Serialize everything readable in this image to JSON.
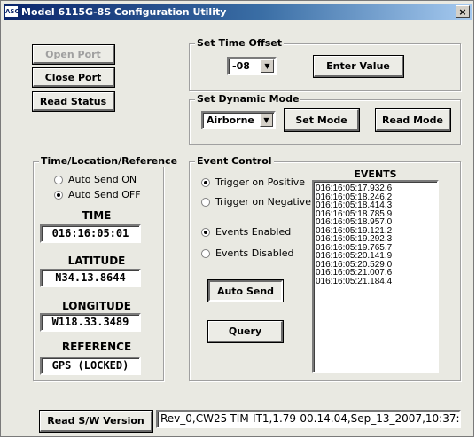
{
  "window": {
    "title": "Model 6115G-8S Configuration Utility",
    "logo_text": "ASC",
    "close_symbol": "×"
  },
  "port_buttons": {
    "open": "Open Port",
    "close": "Close Port",
    "read_status": "Read Status"
  },
  "time_offset": {
    "legend": "Set Time Offset",
    "value": "-08",
    "enter_label": "Enter Value"
  },
  "dynamic_mode": {
    "legend": "Set Dynamic Mode",
    "value": "Airborne",
    "set_label": "Set Mode",
    "read_label": "Read Mode"
  },
  "reference": {
    "legend": "Time/Location/Reference",
    "auto_on": "Auto Send ON",
    "auto_off": "Auto Send OFF",
    "auto_selected": "off",
    "time_label": "TIME",
    "time_value": "016:16:05:01",
    "lat_label": "LATITUDE",
    "lat_value": "N34.13.8644",
    "lon_label": "LONGITUDE",
    "lon_value": "W118.33.3489",
    "ref_label": "REFERENCE",
    "ref_value": "GPS (LOCKED)"
  },
  "event_control": {
    "legend": "Event Control",
    "trigger_pos": "Trigger on Positive",
    "trigger_neg": "Trigger on Negative",
    "enabled": "Events Enabled",
    "disabled": "Events Disabled",
    "auto_send": "Auto Send",
    "query": "Query",
    "events_header": "EVENTS",
    "events": [
      "016:16:05:17.932.6",
      "016:16:05:18.246.2",
      "016:16:05:18.414.3",
      "016:16:05:18.785.9",
      "016:16:05:18.957.0",
      "016:16:05:19.121.2",
      "016:16:05:19.292.3",
      "016:16:05:19.765.7",
      "016:16:05:20.141.9",
      "016:16:05:20.529.0",
      "016:16:05:21.007.6",
      "016:16:05:21.184.4"
    ]
  },
  "version": {
    "button": "Read S/W Version",
    "value": "Rev_0,CW25-TIM-IT1,1.79-00.14.04,Sep_13_2007,10:37:23"
  }
}
